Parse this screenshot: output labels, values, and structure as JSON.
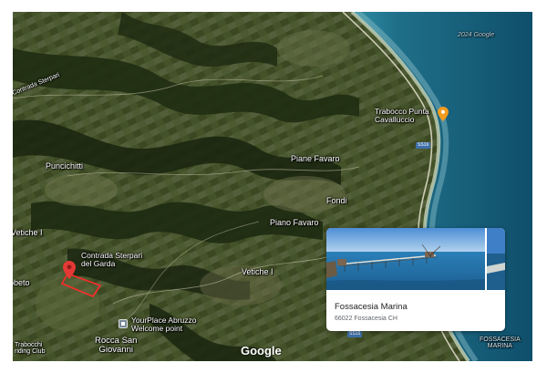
{
  "map": {
    "type": "satellite",
    "watermark": "Google",
    "faint_overlay": "2024 Google",
    "places": {
      "contrada_sterpari_top": "Contrada Sterpari",
      "puncichitti": "Puncichitti",
      "trabocco": "Trabocco Punta\nCavalluccio",
      "piane_favaro": "Piane Favaro",
      "fondi": "Fondi",
      "piano_favaro": "Piano Favaro",
      "vetiche_left": "Vetiche I",
      "vetiche_mid": "Vetiche I",
      "contrada_sterpari_garda": "Contrada Sterpari\ndel Garda",
      "obeto": "obeto",
      "yourplace": "YourPlace Abruzzo\nWelcome point",
      "rocca": "Rocca San\nGiovanni",
      "trabocchi_club": "Trabocchi\nriding Club",
      "fossacesia_marina_corner": "FOSSACESIA\nMARINA"
    },
    "road_shields": {
      "ss16_upper": "SS16",
      "ss16_lower": "SS16"
    },
    "colors": {
      "sea": "#17607a",
      "sea_shallow": "#2d8aa0",
      "land": "#3c4a25",
      "pin_red": "#e53935",
      "parcel_outline": "#ff2a2a",
      "poi_orange": "#f29b1d"
    }
  },
  "place_card": {
    "title": "Fossacesia Marina",
    "address": "66022 Fossacesia CH"
  }
}
